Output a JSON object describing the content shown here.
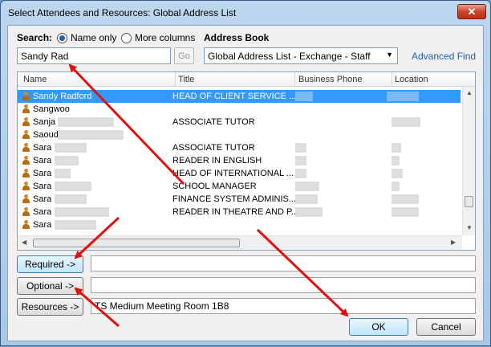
{
  "window": {
    "title": "Select Attendees and Resources: Global Address List",
    "close_glyph": "✕"
  },
  "search": {
    "label": "Search:",
    "options": [
      "Name only",
      "More columns"
    ],
    "selected": "Name only",
    "query": "Sandy Rad",
    "go_label": "Go"
  },
  "address_book": {
    "label": "Address Book",
    "selected": "Global Address List - Exchange - Staff",
    "advanced_find": "Advanced Find"
  },
  "table": {
    "columns": [
      "Name",
      "Title",
      "Business Phone",
      "Location"
    ],
    "rows": [
      {
        "name": "Sandy Radford",
        "title": "HEAD OF CLIENT SERVICE ...",
        "selected": true
      },
      {
        "name": "Sangwoo",
        "title": ""
      },
      {
        "name": "Sanja",
        "title": "ASSOCIATE TUTOR"
      },
      {
        "name": "Saoud",
        "title": ""
      },
      {
        "name": "Sara",
        "title": "ASSOCIATE TUTOR"
      },
      {
        "name": "Sara",
        "title": "READER IN ENGLISH"
      },
      {
        "name": "Sara",
        "title": "HEAD OF INTERNATIONAL ..."
      },
      {
        "name": "Sara",
        "title": "SCHOOL MANAGER"
      },
      {
        "name": "Sara",
        "title": "FINANCE SYSTEM ADMINIS..."
      },
      {
        "name": "Sara",
        "title": "READER IN THEATRE AND P..."
      },
      {
        "name": "Sara",
        "title": ""
      }
    ]
  },
  "recipients": {
    "required_label": "Required ->",
    "required_value": "",
    "optional_label": "Optional ->",
    "optional_value": "",
    "resources_label": "Resources ->",
    "resources_value": "TS Medium Meeting Room 1B8"
  },
  "footer": {
    "ok_label": "OK",
    "cancel_label": "Cancel"
  },
  "colors": {
    "selection": "#3399ff",
    "link": "#1f5fa8",
    "annotation_arrow": "#e01010"
  }
}
